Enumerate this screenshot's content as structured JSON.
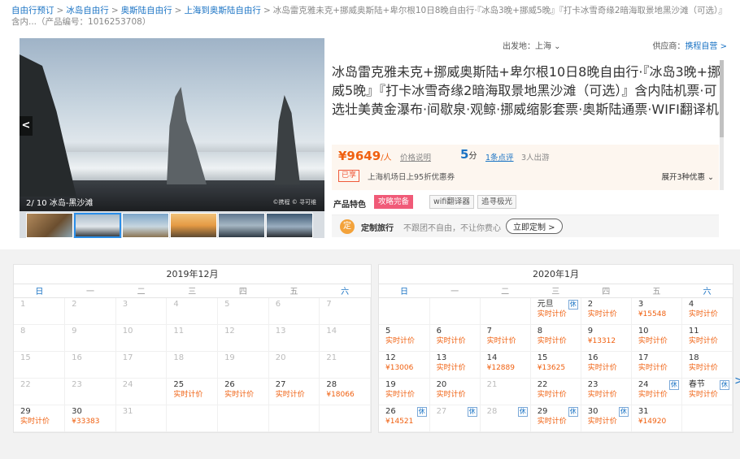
{
  "breadcrumb": {
    "items": [
      "自由行预订",
      "冰岛自由行",
      "奥斯陆自由行",
      "上海到奥斯陆自由行"
    ],
    "current": "冰岛雷克雅未克+挪威奥斯陆+卑尔根10日8晚自由行·『冰岛3晚+挪威5晚』『打卡冰雪奇缘2暗海取景地黑沙滩（可选）』含内...（产品编号：1016253708）",
    "separator": ">"
  },
  "gallery": {
    "caption": "2/ 10 冰岛-黑沙滩",
    "watermark": "©携程 © 寻可维",
    "prev_arrow": "<"
  },
  "info": {
    "departure": "出发地：上海 ⌄",
    "supplier_label": "供应商：",
    "supplier": "携程自营 >",
    "title": "冰岛雷克雅未克+挪威奥斯陆+卑尔根10日8晚自由行·『冰岛3晚+挪威5晚』『打卡冰雪奇缘2暗海取景地黑沙滩（可选）』含内陆机票·可选壮美黄金瀑布·间歇泉·观鲸·挪威缩影套票·奥斯陆通票·WIFI翻译机",
    "price": "¥9649",
    "price_unit": "/人",
    "price_note": "价格说明",
    "score": "5",
    "score_unit": "分",
    "reviews": "1条点评",
    "trips": "3人出游",
    "promo_badge": "已享",
    "promo_text": "上海机场日上95折优惠券",
    "expand": "展开3种优惠 ⌄",
    "features_label": "产品特色",
    "tags": [
      "攻略完备",
      "wifi翻译器",
      "追寻极光"
    ],
    "custom_icon": "定",
    "custom_name": "定制旅行",
    "custom_desc": "不跟团不自由，不让你费心",
    "custom_button": "立即定制 >"
  },
  "calendar": {
    "weekdays": [
      "日",
      "一",
      "二",
      "三",
      "四",
      "五",
      "六"
    ],
    "months": [
      {
        "title": "2019年12月",
        "weeks": [
          [
            {
              "d": "1",
              "past": true
            },
            {
              "d": "2",
              "past": true
            },
            {
              "d": "3",
              "past": true
            },
            {
              "d": "4",
              "past": true
            },
            {
              "d": "5",
              "past": true
            },
            {
              "d": "6",
              "past": true
            },
            {
              "d": "7",
              "past": true
            }
          ],
          [
            {
              "d": "8",
              "past": true
            },
            {
              "d": "9",
              "past": true
            },
            {
              "d": "10",
              "past": true
            },
            {
              "d": "11",
              "past": true
            },
            {
              "d": "12",
              "past": true
            },
            {
              "d": "13",
              "past": true
            },
            {
              "d": "14",
              "past": true
            }
          ],
          [
            {
              "d": "15",
              "past": true
            },
            {
              "d": "16",
              "past": true
            },
            {
              "d": "17",
              "past": true
            },
            {
              "d": "18",
              "past": true
            },
            {
              "d": "19",
              "past": true
            },
            {
              "d": "20",
              "past": true
            },
            {
              "d": "21",
              "past": true
            }
          ],
          [
            {
              "d": "22",
              "past": true
            },
            {
              "d": "23",
              "past": true
            },
            {
              "d": "24",
              "past": true
            },
            {
              "d": "25",
              "p": "实时计价"
            },
            {
              "d": "26",
              "p": "实时计价"
            },
            {
              "d": "27",
              "p": "实时计价"
            },
            {
              "d": "28",
              "p": "¥18066"
            }
          ],
          [
            {
              "d": "29",
              "p": "实时计价"
            },
            {
              "d": "30",
              "p": "¥33383"
            },
            {
              "d": "31",
              "past": true
            },
            {
              "d": ""
            },
            {
              "d": ""
            },
            {
              "d": ""
            },
            {
              "d": ""
            }
          ]
        ]
      },
      {
        "title": "2020年1月",
        "weeks": [
          [
            {
              "d": ""
            },
            {
              "d": ""
            },
            {
              "d": ""
            },
            {
              "d": "元旦",
              "p": "实时计价",
              "rest": "休"
            },
            {
              "d": "2",
              "p": "实时计价"
            },
            {
              "d": "3",
              "p": "¥15548"
            },
            {
              "d": "4",
              "p": "实时计价"
            }
          ],
          [
            {
              "d": "5",
              "p": "实时计价"
            },
            {
              "d": "6",
              "p": "实时计价"
            },
            {
              "d": "7",
              "p": "实时计价"
            },
            {
              "d": "8",
              "p": "实时计价"
            },
            {
              "d": "9",
              "p": "¥13312"
            },
            {
              "d": "10",
              "p": "实时计价"
            },
            {
              "d": "11",
              "p": "实时计价"
            }
          ],
          [
            {
              "d": "12",
              "p": "¥13006"
            },
            {
              "d": "13",
              "p": "实时计价"
            },
            {
              "d": "14",
              "p": "¥12889"
            },
            {
              "d": "15",
              "p": "¥13625"
            },
            {
              "d": "16",
              "p": "实时计价"
            },
            {
              "d": "17",
              "p": "实时计价"
            },
            {
              "d": "18",
              "p": "实时计价"
            }
          ],
          [
            {
              "d": "19",
              "p": "实时计价"
            },
            {
              "d": "20",
              "p": "实时计价"
            },
            {
              "d": "21",
              "past": true
            },
            {
              "d": "22",
              "p": "实时计价"
            },
            {
              "d": "23",
              "p": "实时计价"
            },
            {
              "d": "24",
              "p": "实时计价",
              "rest": "休"
            },
            {
              "d": "春节",
              "p": "实时计价",
              "rest": "休"
            }
          ],
          [
            {
              "d": "26",
              "p": "¥14521",
              "rest": "休"
            },
            {
              "d": "27",
              "past": true,
              "rest": "休"
            },
            {
              "d": "28",
              "past": true,
              "rest": "休"
            },
            {
              "d": "29",
              "p": "实时计价",
              "rest": "休"
            },
            {
              "d": "30",
              "p": "实时计价",
              "rest": "休"
            },
            {
              "d": "31",
              "p": "¥14920"
            },
            {
              "d": ""
            }
          ]
        ]
      }
    ],
    "next_arrow": ">"
  }
}
